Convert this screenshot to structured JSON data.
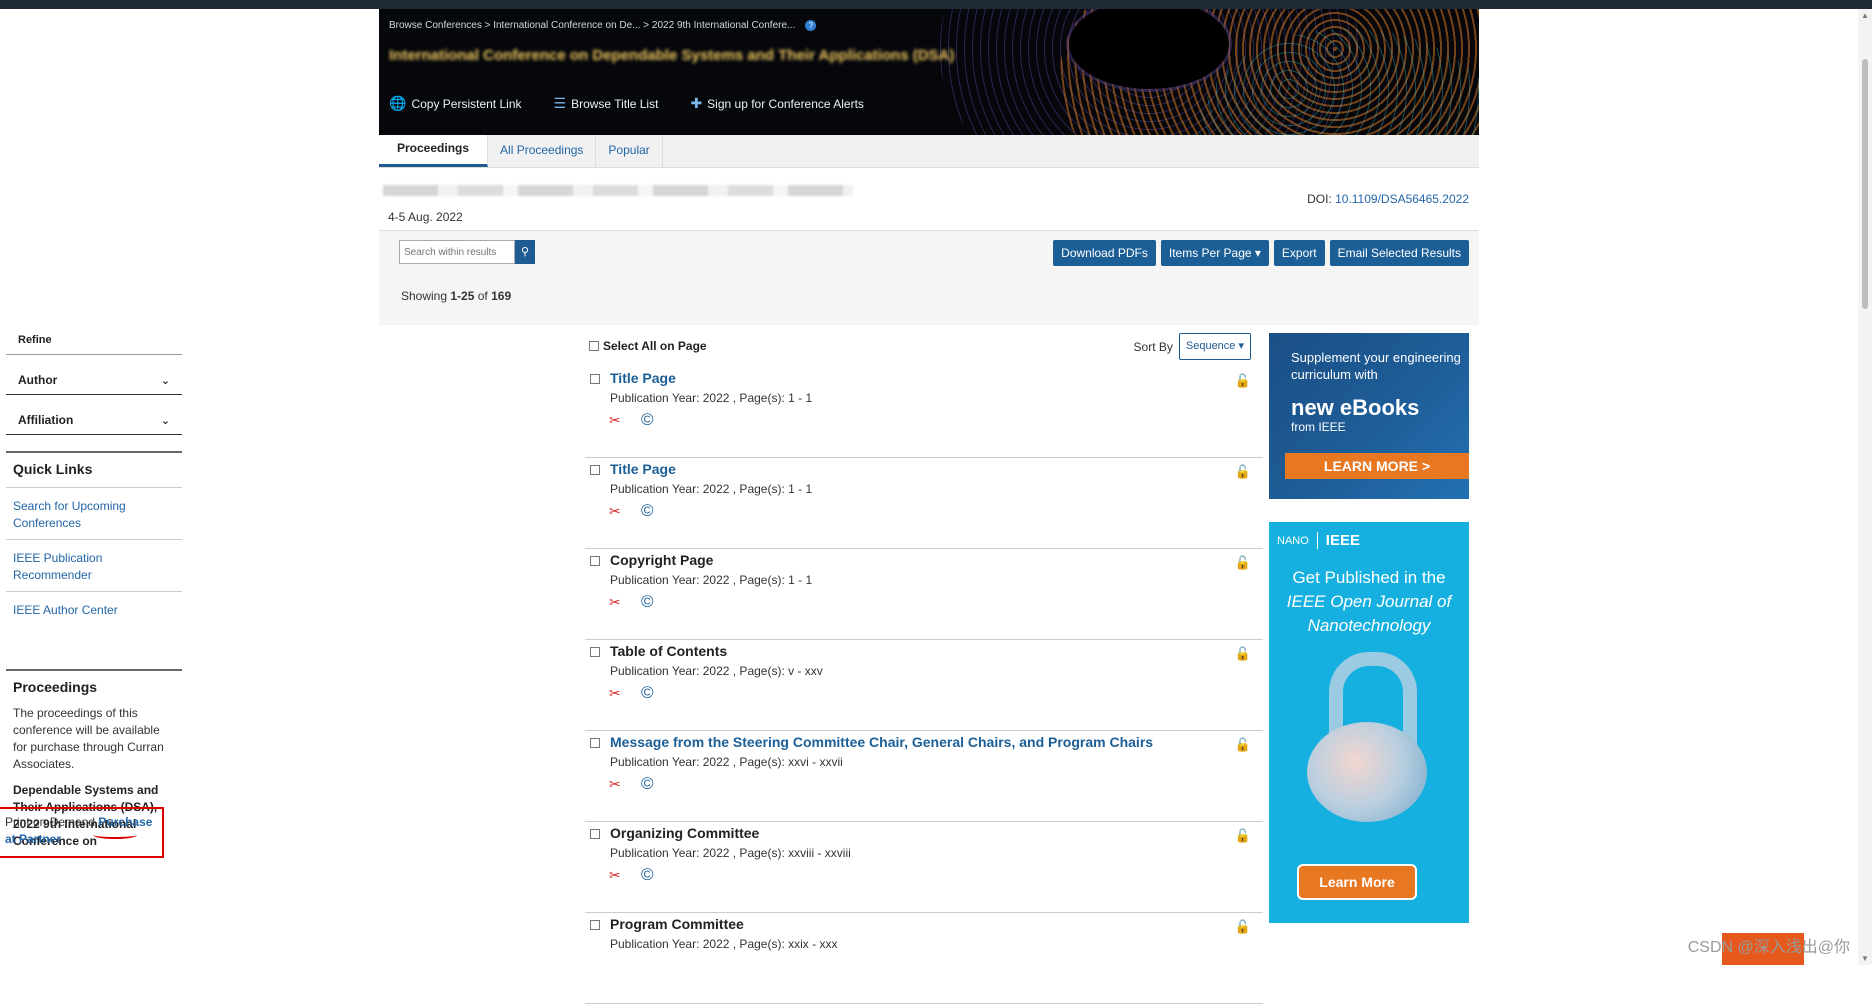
{
  "breadcrumb": {
    "text": "Browse Conferences > International Conference on De... > 2022 9th International Confere...",
    "help": "?"
  },
  "banner": {
    "title": "International Conference on Dependable Systems and Their Applications (DSA)",
    "actions": [
      {
        "icon": "globe-icon",
        "glyph": "🌐",
        "label": "Copy Persistent Link"
      },
      {
        "icon": "list-icon",
        "glyph": "☰",
        "label": "Browse Title List"
      },
      {
        "icon": "plus-icon",
        "glyph": "✚",
        "label": "Sign up for Conference Alerts"
      }
    ]
  },
  "tabs": [
    "Proceedings",
    "All Proceedings",
    "Popular"
  ],
  "info": {
    "date": "4-5 Aug. 2022",
    "doi_label": "DOI:",
    "doi_value": "10.1109/DSA56465.2022"
  },
  "toolbar": {
    "search_placeholder": "Search within results",
    "buttons": [
      "Download PDFs",
      "Items Per Page ▾",
      "Export",
      "Email Selected Results"
    ],
    "showing_prefix": "Showing",
    "showing_range": "1-25",
    "showing_of": "of",
    "showing_total": "169"
  },
  "sidebar": {
    "refine": "Refine",
    "facets": [
      "Author",
      "Affiliation"
    ],
    "quick_links_title": "Quick Links",
    "quick_links": [
      "Search for Upcoming Conferences",
      "IEEE Publication Recommender",
      "IEEE Author Center"
    ],
    "proceedings_title": "Proceedings",
    "proceedings_text": "The proceedings of this conference will be available for purchase through Curran Associates.",
    "proceedings_name": "Dependable Systems and Their Applications (DSA), 2022 9th International Conference on",
    "pod_prefix": "Print on Demand",
    "pod_link": "Purchase at Partner"
  },
  "results": {
    "select_all": "Select All on Page",
    "sort_label": "Sort By",
    "sort_value": "Sequence ▾",
    "items": [
      {
        "title": "Title Page",
        "link": true,
        "meta": "Publication Year: 2022 , Page(s): 1  -  1"
      },
      {
        "title": "Title Page",
        "link": true,
        "meta": "Publication Year: 2022 , Page(s): 1  -  1"
      },
      {
        "title": "Copyright Page",
        "link": false,
        "meta": "Publication Year: 2022 , Page(s): 1  -  1"
      },
      {
        "title": "Table of Contents",
        "link": false,
        "meta": "Publication Year: 2022 , Page(s): v  -  xxv"
      },
      {
        "title": "Message from the Steering Committee Chair, General Chairs, and Program Chairs",
        "link": true,
        "meta": "Publication Year: 2022 , Page(s): xxvi  -  xxvii"
      },
      {
        "title": "Organizing Committee",
        "link": false,
        "meta": "Publication Year: 2022 , Page(s): xxviii  -  xxviii"
      },
      {
        "title": "Program Committee",
        "link": false,
        "meta": "Publication Year: 2022 , Page(s): xxix  -  xxx"
      }
    ]
  },
  "ads": {
    "ad1": {
      "line1": "Supplement your engineering curriculum with",
      "line2": "new eBooks",
      "line3": "from IEEE",
      "cta": "LEARN MORE >"
    },
    "ad2": {
      "brand": "IEEE",
      "nano": "NANO",
      "line1": "Get Published in the",
      "line2": "IEEE Open Journal of Nanotechnology",
      "cta": "Learn More"
    }
  },
  "watermark": "CSDN @深入浅出@你",
  "colors": {
    "accent": "#1c5f97",
    "link": "#2266a8",
    "cta": "#e87722",
    "pdf": "#d52020",
    "open_access": "#2e8b2e"
  }
}
